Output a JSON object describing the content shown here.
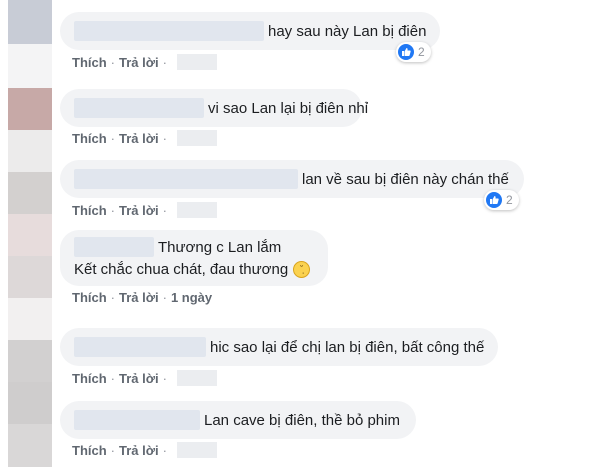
{
  "colors": {
    "bubble_bg": "#f2f3f5",
    "action_text": "#606770",
    "like_blue": "#2078f4"
  },
  "actions": {
    "like": "Thích",
    "reply": "Trả lời"
  },
  "comments": [
    {
      "text": "hay sau này Lan bị điên",
      "reaction_count": "2",
      "timestamp": ""
    },
    {
      "text": "vi sao Lan lại bị điên nhỉ",
      "timestamp": ""
    },
    {
      "text": "lan về sau bị điên này chán thế",
      "reaction_count": "2",
      "timestamp": ""
    },
    {
      "line1": "Thương c Lan lắm",
      "line2": "Kết chắc chua chát, đau thương",
      "emoji": "crying-face-icon",
      "timestamp": "1 ngày"
    },
    {
      "text": "hic sao lại để chị lan bị điên, bất công thế",
      "timestamp": ""
    },
    {
      "text": "Lan cave bị điên, thề bỏ phim",
      "timestamp": ""
    }
  ]
}
